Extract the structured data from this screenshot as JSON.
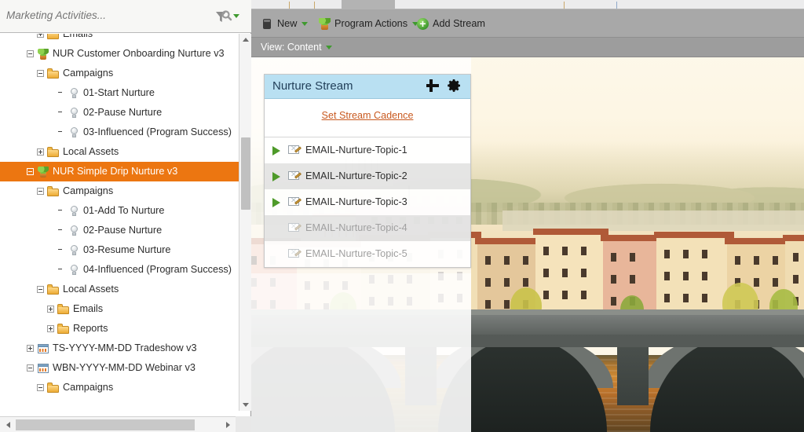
{
  "sidebar": {
    "search": {
      "placeholder": "Marketing Activities...",
      "value": ""
    },
    "filter_icon": "filter-magnifier-icon",
    "tree": [
      {
        "label": "Emails",
        "indent": 3,
        "toggle": "plus",
        "icon": "folder"
      },
      {
        "label": "NUR Customer Onboarding Nurture v3",
        "indent": 2,
        "toggle": "minus",
        "icon": "program"
      },
      {
        "label": "Campaigns",
        "indent": 3,
        "toggle": "minus",
        "icon": "folder"
      },
      {
        "label": "01-Start Nurture",
        "indent": 5,
        "toggle": "none",
        "icon": "bulb"
      },
      {
        "label": "02-Pause Nurture",
        "indent": 5,
        "toggle": "none",
        "icon": "bulb"
      },
      {
        "label": "03-Influenced (Program Success)",
        "indent": 5,
        "toggle": "none",
        "icon": "bulb"
      },
      {
        "label": "Local Assets",
        "indent": 3,
        "toggle": "plus",
        "icon": "folder"
      },
      {
        "label": "NUR Simple Drip Nurture v3",
        "indent": 2,
        "toggle": "minus",
        "icon": "program",
        "selected": true
      },
      {
        "label": "Campaigns",
        "indent": 3,
        "toggle": "minus",
        "icon": "folder"
      },
      {
        "label": "01-Add To Nurture",
        "indent": 5,
        "toggle": "none",
        "icon": "bulb"
      },
      {
        "label": "02-Pause Nurture",
        "indent": 5,
        "toggle": "none",
        "icon": "bulb"
      },
      {
        "label": "03-Resume Nurture",
        "indent": 5,
        "toggle": "none",
        "icon": "bulb"
      },
      {
        "label": "04-Influenced (Program Success)",
        "indent": 5,
        "toggle": "none",
        "icon": "bulb"
      },
      {
        "label": "Local Assets",
        "indent": 3,
        "toggle": "minus",
        "icon": "folder"
      },
      {
        "label": "Emails",
        "indent": 4,
        "toggle": "plus",
        "icon": "folder"
      },
      {
        "label": "Reports",
        "indent": 4,
        "toggle": "plus",
        "icon": "folder"
      },
      {
        "label": "TS-YYYY-MM-DD Tradeshow v3",
        "indent": 2,
        "toggle": "plus",
        "icon": "event"
      },
      {
        "label": "WBN-YYYY-MM-DD Webinar v3",
        "indent": 2,
        "toggle": "minus",
        "icon": "event"
      },
      {
        "label": "Campaigns",
        "indent": 3,
        "toggle": "minus",
        "icon": "folder"
      }
    ],
    "selected_color": "#ec7611"
  },
  "toolbar": {
    "new_label": "New",
    "program_actions_label": "Program Actions",
    "add_stream_label": "Add Stream",
    "new_icon": "new-document-icon",
    "program_actions_icon": "program-plant-icon",
    "add_stream_icon": "add-circle-icon"
  },
  "viewbar": {
    "label": "View: Content"
  },
  "stream": {
    "title": "Nurture Stream",
    "add_icon": "plus-icon",
    "settings_icon": "gear-icon",
    "cadence_link": "Set Stream Cadence",
    "header_color": "#b9e0f2",
    "link_color": "#c8591f",
    "emails": [
      {
        "name": "EMAIL-Nurture-Topic-1",
        "active": true
      },
      {
        "name": "EMAIL-Nurture-Topic-2",
        "active": true
      },
      {
        "name": "EMAIL-Nurture-Topic-3",
        "active": true
      },
      {
        "name": "EMAIL-Nurture-Topic-4",
        "active": false
      },
      {
        "name": "EMAIL-Nurture-Topic-5",
        "active": false
      }
    ]
  }
}
